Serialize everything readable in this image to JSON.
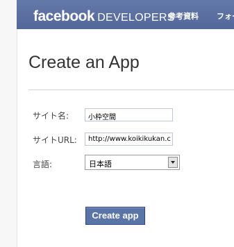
{
  "header": {
    "brand": "facebook",
    "brand_sub": "DEVELOPERS",
    "nav": [
      "参考資料",
      "フォー"
    ]
  },
  "page": {
    "title": "Create an App"
  },
  "form": {
    "site_name_label": "サイト名:",
    "site_name_value": "小枠空間",
    "site_url_label": "サイトURL:",
    "site_url_value": "http://www.koikikukan.c",
    "language_label": "言語:",
    "language_value": "日本語",
    "submit_label": "Create app"
  },
  "colors": {
    "header_bg": "#5a6e9e",
    "button_bg": "#5b74a8"
  }
}
